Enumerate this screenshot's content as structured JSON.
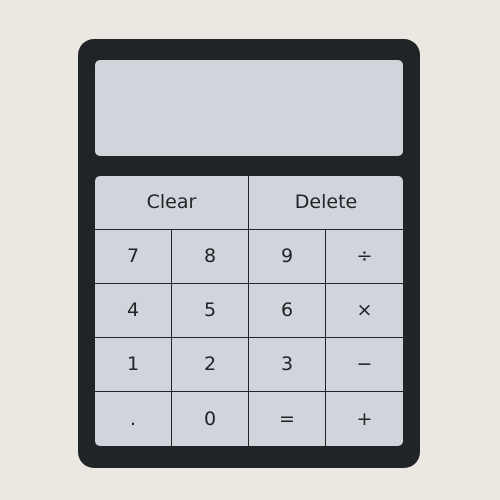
{
  "display": {
    "value": ""
  },
  "keys": {
    "clear": "Clear",
    "delete": "Delete",
    "seven": "7",
    "eight": "8",
    "nine": "9",
    "divide": "÷",
    "four": "4",
    "five": "5",
    "six": "6",
    "multiply": "×",
    "one": "1",
    "two": "2",
    "three": "3",
    "subtract": "−",
    "decimal": ".",
    "zero": "0",
    "equals": "=",
    "add": "+"
  },
  "colors": {
    "page_background": "#ebe8e2",
    "body": "#212427",
    "panel": "#d0d4db"
  }
}
